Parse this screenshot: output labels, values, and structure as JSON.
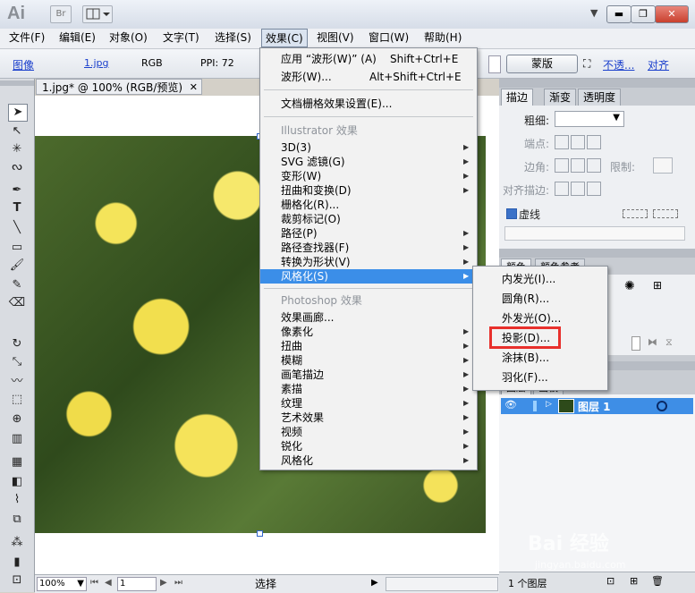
{
  "app": {
    "logo": "Ai",
    "bridge_chip": "Br"
  },
  "window_buttons": {
    "minimize": "▬",
    "restore": "❐",
    "close": "✕"
  },
  "menubar": [
    {
      "label": "文件(F)"
    },
    {
      "label": "编辑(E)"
    },
    {
      "label": "对象(O)"
    },
    {
      "label": "文字(T)"
    },
    {
      "label": "选择(S)"
    },
    {
      "label": "效果(C)"
    },
    {
      "label": "视图(V)"
    },
    {
      "label": "窗口(W)"
    },
    {
      "label": "帮助(H)"
    }
  ],
  "controlbar": {
    "object_type": "图像",
    "file": "1.jpg",
    "color_mode": "RGB",
    "ppi": "PPI: 72",
    "mask_button": "蒙版",
    "opacity_link": "不透...",
    "align_link": "对齐"
  },
  "document": {
    "tab_title": "1.jpg* @ 100% (RGB/预览)"
  },
  "statusbar": {
    "zoom": "100%",
    "page": "1",
    "tool": "选择"
  },
  "effect_menu": {
    "apply_last": "应用 “波形(W)” (A)",
    "apply_last_shortcut": "Shift+Ctrl+E",
    "last_effect": "波形(W)...",
    "last_effect_shortcut": "Alt+Shift+Ctrl+E",
    "raster_settings": "文档栅格效果设置(E)...",
    "illustrator_header": "Illustrator 效果",
    "illustrator_items": [
      "3D(3)",
      "SVG 滤镜(G)",
      "变形(W)",
      "扭曲和变换(D)",
      "栅格化(R)...",
      "裁剪标记(O)",
      "路径(P)",
      "路径查找器(F)",
      "转换为形状(V)",
      "风格化(S)"
    ],
    "photoshop_header": "Photoshop 效果",
    "photoshop_items": [
      "效果画廊...",
      "像素化",
      "扭曲",
      "模糊",
      "画笔描边",
      "素描",
      "纹理",
      "艺术效果",
      "视频",
      "锐化",
      "风格化"
    ]
  },
  "stylize_submenu": [
    "内发光(I)...",
    "圆角(R)...",
    "外发光(O)...",
    "投影(D)...",
    "涂抹(B)...",
    "羽化(F)..."
  ],
  "stroke_panel": {
    "tabs": [
      "描边",
      "渐变",
      "透明度"
    ],
    "weight_label": "粗细:",
    "cap_label": "端点:",
    "corner_label": "边角:",
    "limit_label": "限制:",
    "align_label": "对齐描边:",
    "dashed_label": "虚线"
  },
  "color_panel": {
    "tabs": [
      "颜色",
      "颜色参考"
    ]
  },
  "layers_panel": {
    "tabs": [
      "图层",
      "画板"
    ],
    "layer_name": "图层 1",
    "footer": "1 个图层"
  },
  "watermark": {
    "brand": "Bai 经验",
    "url": "jingyan.baidu.com"
  },
  "colors": {
    "highlight": "#3b8ee8",
    "annotation_box": "#e8302c",
    "link": "#1a3fcc"
  }
}
